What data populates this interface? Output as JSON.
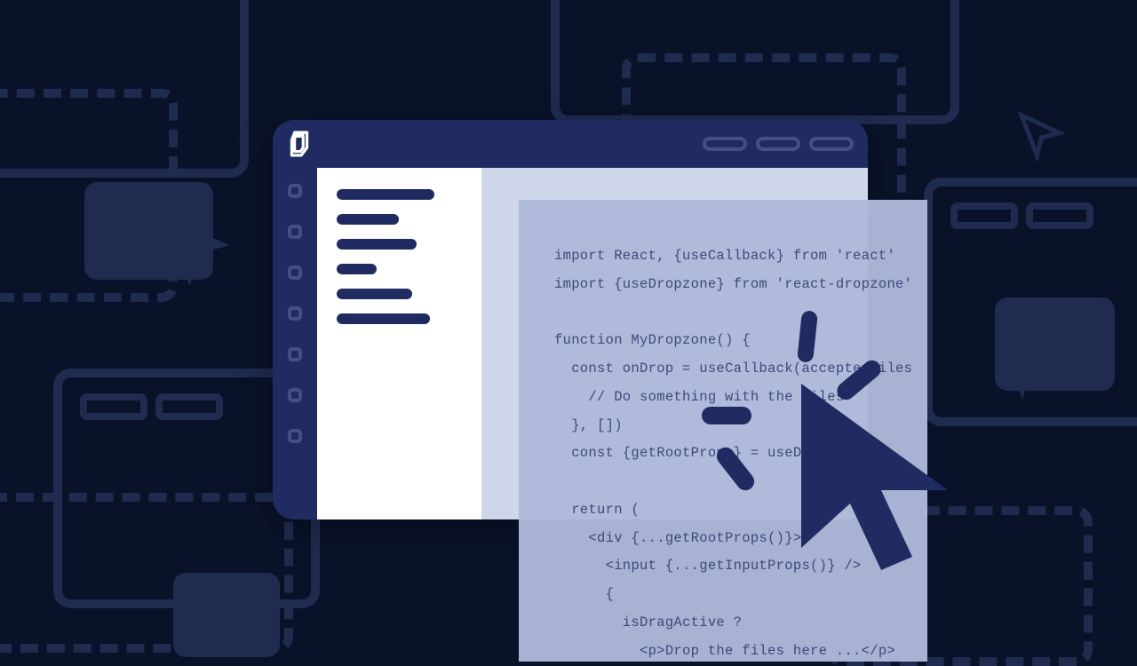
{
  "code": {
    "lines": [
      "import React, {useCallback} from 'react'",
      "import {useDropzone} from 'react-dropzone'",
      "",
      "function MyDropzone() {",
      "  const onDrop = useCallback(acceptedFiles",
      "    // Do something with the files",
      "  }, [])",
      "  const {getRootProps} = useDropzone",
      "",
      "  return (",
      "    <div {...getRootProps()}>",
      "      <input {...getInputProps()} />",
      "      {",
      "        isDragActive ?",
      "          <p>Drop the files here ...</p>"
    ]
  },
  "colors": {
    "bg": "#0a1229",
    "accent": "#202c61",
    "panel": "#aeb8da",
    "codeText": "#3d4a7a"
  }
}
